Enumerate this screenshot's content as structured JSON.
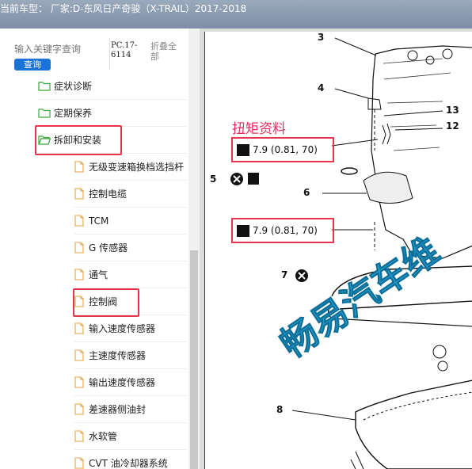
{
  "window": {
    "title": "当前车型：  厂家:D-东风日产奇骏（X-TRAIL）2017-2018"
  },
  "search": {
    "placeholder": "输入关键字查询",
    "button_label": "查询",
    "code": "PC.17-6114",
    "collapse_label": "折叠全部"
  },
  "tree": {
    "items": [
      {
        "label": "症状诊断",
        "icon": "folder-icon",
        "level": 1
      },
      {
        "label": "定期保养",
        "icon": "folder-icon",
        "level": 1
      },
      {
        "label": "拆卸和安装",
        "icon": "folder-open-icon",
        "level": 1
      },
      {
        "label": "无级变速箱换档选挡杆",
        "icon": "document-icon",
        "level": 2
      },
      {
        "label": "控制电缆",
        "icon": "document-icon",
        "level": 2
      },
      {
        "label": "TCM",
        "icon": "document-icon",
        "level": 2
      },
      {
        "label": "G 传感器",
        "icon": "document-icon",
        "level": 2
      },
      {
        "label": "通气",
        "icon": "document-icon",
        "level": 2
      },
      {
        "label": "控制阀",
        "icon": "document-icon",
        "level": 2
      },
      {
        "label": "输入速度传感器",
        "icon": "document-icon",
        "level": 2
      },
      {
        "label": "主速度传感器",
        "icon": "document-icon",
        "level": 2
      },
      {
        "label": "输出速度传感器",
        "icon": "document-icon",
        "level": 2
      },
      {
        "label": "差速器侧油封",
        "icon": "document-icon",
        "level": 2
      },
      {
        "label": "水软管",
        "icon": "document-icon",
        "level": 2
      },
      {
        "label": "CVT 油冷却器系统",
        "icon": "document-icon",
        "level": 2
      }
    ]
  },
  "diagram": {
    "torque_heading": "扭矩资料",
    "torque_values": [
      "7.9 (0.81, 70)",
      "7.9 (0.81, 70)"
    ],
    "callouts": [
      "3",
      "4",
      "5",
      "6",
      "7",
      "8",
      "12",
      "13"
    ],
    "watermark": "畅易汽车维",
    "colors": {
      "highlight": "#e8344a",
      "watermark": "#2aa7d6",
      "torque_heading": "#e03060"
    }
  }
}
